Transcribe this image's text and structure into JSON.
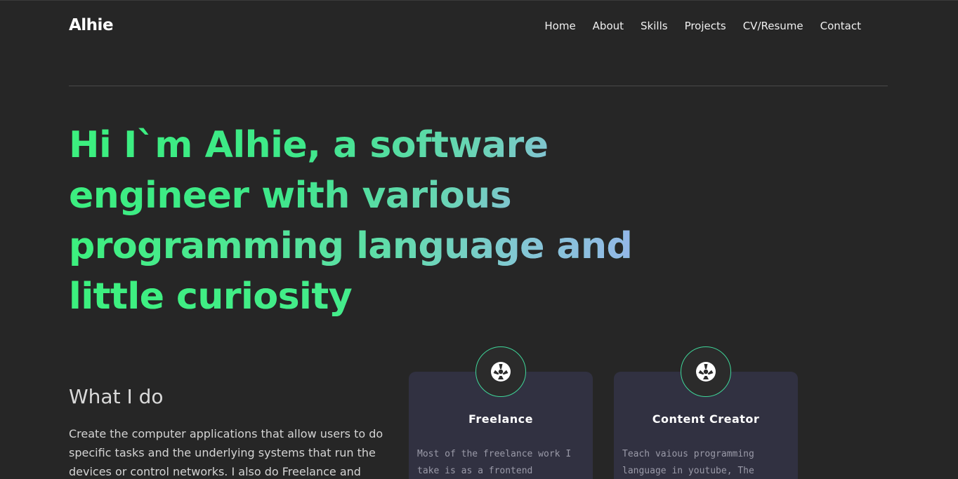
{
  "header": {
    "logo": "Alhie",
    "nav": [
      "Home",
      "About",
      "Skills",
      "Projects",
      "CV/Resume",
      "Contact"
    ]
  },
  "hero": {
    "lines": [
      "Hi I`m Alhie, a software",
      "engineer with various",
      "programming language and",
      "little curiosity"
    ]
  },
  "what_i_do": {
    "title": "What I do",
    "text": "Create the computer applications that allow users to do specific tasks and the underlying systems that run the devices or control networks. I also do Freelance and"
  },
  "cards": [
    {
      "icon": "atom-icon",
      "title": "Freelance",
      "text": "Most of the freelance work I take is as a frontend engineer, but"
    },
    {
      "icon": "atom-icon",
      "title": "Content Creator",
      "text": "Teach vaious programming language in youtube, The"
    }
  ],
  "colors": {
    "background": "#262626",
    "accent_green": "#3cf07e",
    "accent_blue": "#9ab2ef",
    "card_bg": "#313141"
  }
}
